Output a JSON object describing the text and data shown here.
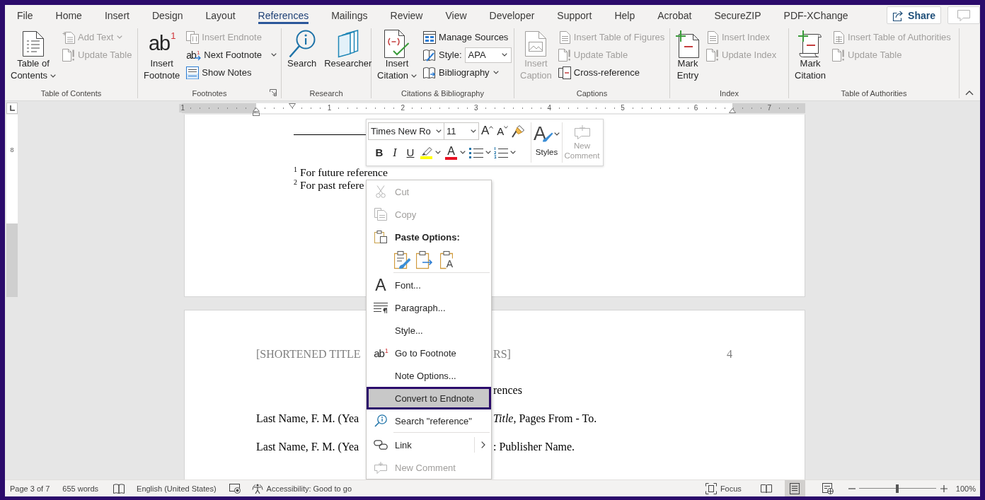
{
  "tabs": [
    {
      "label": "File",
      "selected": false
    },
    {
      "label": "Home",
      "selected": false
    },
    {
      "label": "Insert",
      "selected": false
    },
    {
      "label": "Design",
      "selected": false
    },
    {
      "label": "Layout",
      "selected": false
    },
    {
      "label": "References",
      "selected": true
    },
    {
      "label": "Mailings",
      "selected": false
    },
    {
      "label": "Review",
      "selected": false
    },
    {
      "label": "View",
      "selected": false
    },
    {
      "label": "Developer",
      "selected": false
    },
    {
      "label": "Support",
      "selected": false
    },
    {
      "label": "Help",
      "selected": false
    },
    {
      "label": "Acrobat",
      "selected": false
    },
    {
      "label": "SecureZIP",
      "selected": false
    },
    {
      "label": "PDF-XChange",
      "selected": false
    }
  ],
  "share_button": {
    "label": "Share"
  },
  "ribbon": {
    "groups": [
      {
        "label": "Table of Contents",
        "launcher": false,
        "large": [
          {
            "label": "Table of\nContents",
            "dropdown": true,
            "disabled": false
          }
        ],
        "small": [
          {
            "kind": "button",
            "label": "Add Text",
            "dropdown": true,
            "split": false,
            "disabled": true
          },
          {
            "kind": "button",
            "label": "Update Table",
            "dropdown": false,
            "disabled": true
          }
        ]
      },
      {
        "label": "Footnotes",
        "launcher": true,
        "large": [
          {
            "label": "Insert\nFootnote",
            "glyph": "ab",
            "glyph_sup": "1",
            "dropdown": false,
            "disabled": false
          }
        ],
        "small": [
          {
            "kind": "button",
            "label": "Insert Endnote",
            "dropdown": false,
            "disabled": true
          },
          {
            "kind": "button",
            "label": "Next Footnote",
            "glyph": "ab",
            "glyph_sup": "1",
            "dropdown": true,
            "split": true,
            "disabled": false
          },
          {
            "kind": "button",
            "label": "Show Notes",
            "dropdown": false,
            "disabled": false
          }
        ]
      },
      {
        "label": "Research",
        "launcher": false,
        "large": [
          {
            "label": "Search",
            "dropdown": false,
            "disabled": false
          },
          {
            "label": "Researcher",
            "dropdown": false,
            "disabled": false
          }
        ]
      },
      {
        "label": "Citations & Bibliography",
        "launcher": false,
        "large": [
          {
            "label": "Insert\nCitation",
            "dropdown": true,
            "disabled": false
          }
        ],
        "small": [
          {
            "kind": "button",
            "label": "Manage Sources",
            "dropdown": false,
            "disabled": false
          },
          {
            "kind": "select",
            "label": "Style:",
            "value": "APA",
            "disabled": false
          },
          {
            "kind": "button",
            "label": "Bibliography",
            "dropdown": true,
            "split": false,
            "disabled": false
          }
        ]
      },
      {
        "label": "Captions",
        "launcher": false,
        "large": [
          {
            "label": "Insert\nCaption",
            "dropdown": false,
            "disabled": true
          }
        ],
        "small": [
          {
            "kind": "button",
            "label": "Insert Table of Figures",
            "dropdown": false,
            "disabled": true
          },
          {
            "kind": "button",
            "label": "Update Table",
            "dropdown": false,
            "disabled": true
          },
          {
            "kind": "button",
            "label": "Cross-reference",
            "dropdown": false,
            "disabled": false
          }
        ]
      },
      {
        "label": "Index",
        "launcher": false,
        "large": [
          {
            "label": "Mark\nEntry",
            "dropdown": false,
            "disabled": false
          }
        ],
        "small": [
          {
            "kind": "button",
            "label": "Insert Index",
            "dropdown": false,
            "disabled": true
          },
          {
            "kind": "button",
            "label": "Update Index",
            "dropdown": false,
            "disabled": true
          }
        ]
      },
      {
        "label": "Table of Authorities",
        "launcher": false,
        "large": [
          {
            "label": "Mark\nCitation",
            "dropdown": false,
            "disabled": false
          }
        ],
        "small": [
          {
            "kind": "button",
            "label": "Insert Table of Authorities",
            "dropdown": false,
            "disabled": true
          },
          {
            "kind": "button",
            "label": "Update Table",
            "dropdown": false,
            "disabled": true
          }
        ]
      }
    ]
  },
  "ruler": {
    "labels": [
      "1",
      "1",
      "2",
      "3",
      "4",
      "5",
      "6",
      "7"
    ],
    "vertical_labels": [
      "8"
    ]
  },
  "pages": [
    {
      "lines": [
        {
          "kind": "footnote",
          "left": "$^{1}$ For future reference"
        },
        {
          "kind": "footnote",
          "left": "$^{2}$ For past refere"
        }
      ]
    },
    {
      "header": {
        "left": "[SHORTENED TITLE",
        "right": "RS]",
        "page_number": "4"
      },
      "lines": [
        {
          "kind": "heading",
          "right": "rences"
        },
        {
          "kind": "reference",
          "left": "Last Name, F. M. (Yea",
          "right": "*Title*, Pages From - To."
        },
        {
          "kind": "reference",
          "left": "Last Name, F. M. (Yea",
          "right": ": Publisher Name."
        }
      ]
    }
  ],
  "mini_toolbar": {
    "font": "Times New Ro",
    "size": "11",
    "grow_glyph": "A",
    "shrink_glyph": "A",
    "format": [
      "B",
      "I",
      "U"
    ],
    "highlight": {
      "color": "#ffff00"
    },
    "font_color": {
      "glyph": "A",
      "color": "#e81123"
    },
    "styles": {
      "label": "Styles",
      "glyph": "A"
    },
    "new_comment": {
      "label": "New\nComment",
      "disabled": true
    }
  },
  "context_menu": {
    "items": [
      {
        "kind": "item",
        "label": "Cut",
        "disabled": true,
        "selected": false
      },
      {
        "kind": "item",
        "label": "Copy",
        "disabled": true,
        "selected": false
      },
      {
        "kind": "header",
        "label": "Paste Options:"
      },
      {
        "kind": "paste_options",
        "glyph": "A"
      },
      {
        "kind": "separator"
      },
      {
        "kind": "item",
        "label": "Font...",
        "glyph": "A",
        "disabled": false,
        "selected": false
      },
      {
        "kind": "item",
        "label": "Paragraph...",
        "disabled": false,
        "selected": false
      },
      {
        "kind": "item",
        "label": "Style...",
        "disabled": false,
        "selected": false
      },
      {
        "kind": "item",
        "label": "Go to Footnote",
        "glyph": "ab",
        "glyph_sup": "1",
        "disabled": false,
        "selected": false
      },
      {
        "kind": "item",
        "label": "Note Options...",
        "disabled": false,
        "selected": false
      },
      {
        "kind": "item",
        "label": "Convert to Endnote",
        "disabled": false,
        "selected": true
      },
      {
        "kind": "item",
        "label": "Search \"reference\"",
        "disabled": false,
        "selected": false
      },
      {
        "kind": "separator"
      },
      {
        "kind": "item",
        "label": "Link",
        "submenu": true,
        "disabled": false,
        "selected": false
      },
      {
        "kind": "item",
        "label": "New Comment",
        "disabled": true,
        "selected": false
      }
    ]
  },
  "status_bar": {
    "page": "Page 3 of 7",
    "words": "655 words",
    "language": "English (United States)",
    "accessibility": "Accessibility: Good to go",
    "focus": "Focus",
    "views": [
      {
        "selected": false
      },
      {
        "selected": true
      },
      {
        "selected": false
      }
    ],
    "zoom": {
      "level": 0.5,
      "label": "100%"
    }
  }
}
